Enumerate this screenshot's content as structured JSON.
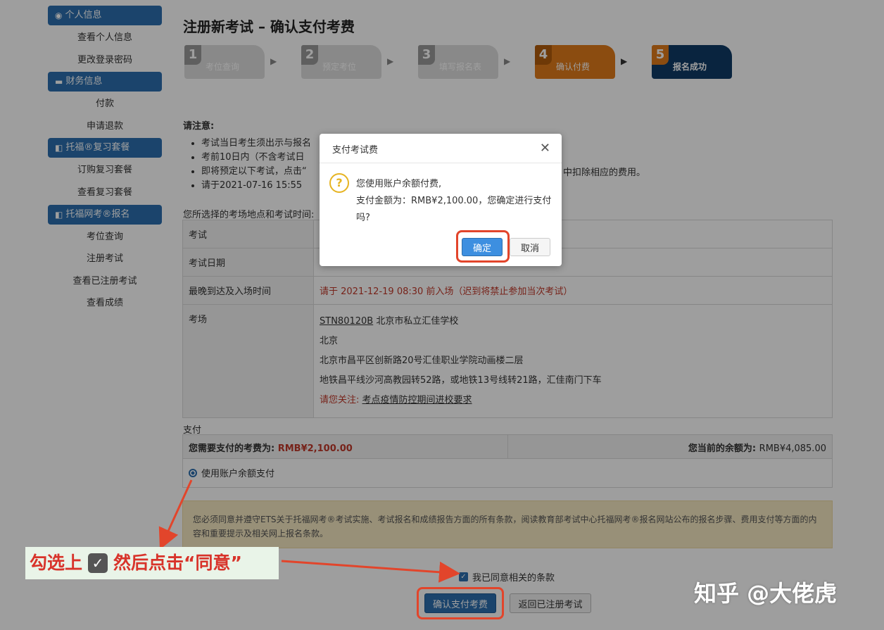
{
  "sidebar": {
    "sections": [
      {
        "icon": "user-circle-icon",
        "title": "个人信息",
        "links": [
          "查看个人信息",
          "更改登录密码"
        ]
      },
      {
        "icon": "card-icon",
        "title": "财务信息",
        "links": [
          "付款",
          "申请退款"
        ]
      },
      {
        "icon": "book-icon",
        "title": "托福®复习套餐",
        "links": [
          "订购复习套餐",
          "查看复习套餐"
        ]
      },
      {
        "icon": "book-icon",
        "title": "托福网考®报名",
        "links": [
          "考位查询",
          "注册考试",
          "查看已注册考试",
          "查看成绩"
        ]
      }
    ]
  },
  "page": {
    "title": "注册新考试 – 确认支付考费"
  },
  "steps": [
    {
      "num": "1",
      "label": "考位查询"
    },
    {
      "num": "2",
      "label": "预定考位"
    },
    {
      "num": "3",
      "label": "填写报名表"
    },
    {
      "num": "4",
      "label": "确认付费"
    },
    {
      "num": "5",
      "label": "报名成功"
    }
  ],
  "notice": {
    "title": "请注意:",
    "items": [
      "考试当日考生须出示与报名",
      "考前10日内（不含考试日",
      "即将预定以下考试，点击“",
      "请于2021-07-16 15:55"
    ],
    "item3_tail": "中扣除相应的费用。"
  },
  "exam": {
    "section_label": "您所选择的考场地点和考试时间:",
    "labels": [
      "考试",
      "考试日期",
      "最晚到达及入场时间",
      "考场"
    ],
    "arrival": "请于 2021-12-19 08:30 前入场（迟到将禁止参加当次考试）",
    "venue_code": "STN80120B",
    "venue_name": "北京市私立汇佳学校",
    "city": "北京",
    "address": "北京市昌平区创新路20号汇佳职业学院动画楼二层",
    "transport": "地铁昌平线沙河高教园转52路，或地铁13号线转21路，汇佳南门下车",
    "attention_label": "请您关注:",
    "attention_link": "考点疫情防控期间进校要求"
  },
  "payment": {
    "section_label": "支付",
    "fee_label": "您需要支付的考费为:",
    "fee_value": "RMB¥2,100.00",
    "balance_label": "您当前的余额为:",
    "balance_value": "RMB¥4,085.00",
    "option_label": "使用账户余额支付"
  },
  "terms": {
    "text": "您必须同意并遵守ETS关于托福网考®考试实施、考试报名和成绩报告方面的所有条款，阅读教育部考试中心托福网考®报名网站公布的报名步骤、费用支付等方面的内容和重要提示及相关网上报名条款。",
    "agree_label": "我已同意相关的条款"
  },
  "buttons": {
    "confirm_pay": "确认支付考费",
    "back": "返回已注册考试"
  },
  "dialog": {
    "title": "支付考试费",
    "line1": "您使用账户余额付费,",
    "line2": "支付金额为：RMB¥2,100.00，您确定进行支付吗?",
    "ok": "确定",
    "cancel": "取消"
  },
  "annotation": {
    "before": "勾选上",
    "after": "然后点击“同意”"
  },
  "watermark": "知乎 @大佬虎",
  "colors": {
    "primary": "#2c6fae",
    "active_step": "#e07b1a",
    "done_step": "#0f3b66",
    "highlight": "#e2452b",
    "danger_text": "#c0392b"
  }
}
